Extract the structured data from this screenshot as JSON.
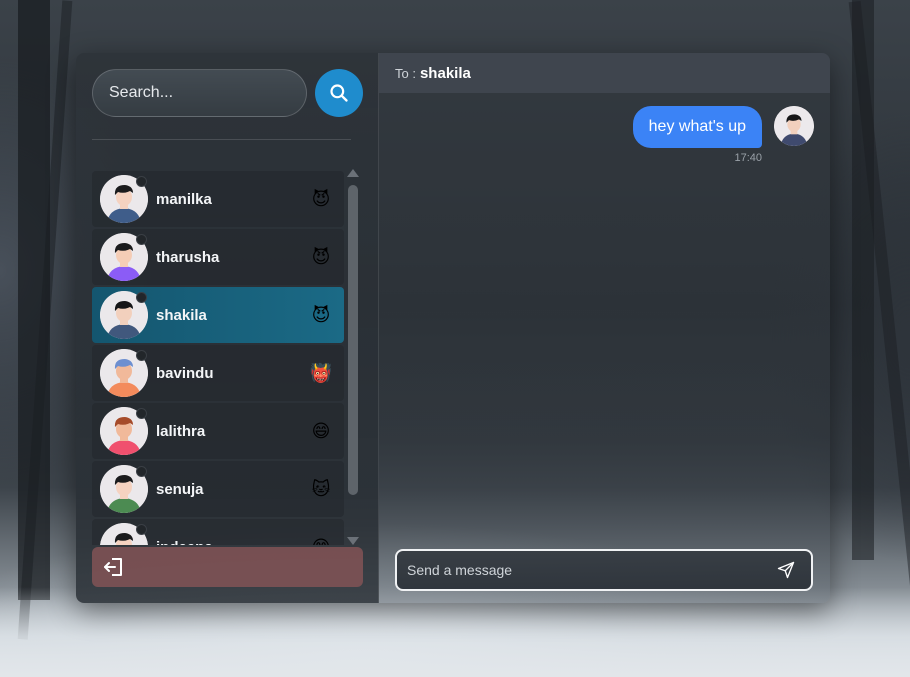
{
  "search": {
    "placeholder": "Search..."
  },
  "contacts": [
    {
      "name": "manilka",
      "emoji": "😈",
      "shirt": "#3f5d8a",
      "hair": "#1b1b1d",
      "skin": "#f5d2c0"
    },
    {
      "name": "tharusha",
      "emoji": "😈",
      "shirt": "#8b5cf6",
      "hair": "#1b1b1d",
      "skin": "#f5cdb6"
    },
    {
      "name": "shakila",
      "emoji": "😈",
      "shirt": "#41587d",
      "hair": "#161618",
      "skin": "#f2d0bd"
    },
    {
      "name": "bavindu",
      "emoji": "👹",
      "shirt": "#f38b5c",
      "hair": "#6d8fd0",
      "skin": "#f1b99a"
    },
    {
      "name": "lalithra",
      "emoji": "😄",
      "shirt": "#f0506e",
      "hair": "#a64b2a",
      "skin": "#f1b99a"
    },
    {
      "name": "senuja",
      "emoji": "🐱",
      "shirt": "#4c8b52",
      "hair": "#1b1b1d",
      "skin": "#f5d2c0"
    },
    {
      "name": "indeepa",
      "emoji": "😄",
      "shirt": "#4a5a7a",
      "hair": "#1b1b1d",
      "skin": "#f5d2c0"
    }
  ],
  "active_contact": "shakila",
  "chat": {
    "to_label": "To :",
    "to_name": "shakila",
    "messages": [
      {
        "text": "hey what's up",
        "time": "17:40",
        "from": "me"
      }
    ],
    "composer_placeholder": "Send a message"
  },
  "colors": {
    "accent": "#1f8ccd",
    "bubble": "#3b83f6",
    "active_row": "#14566f",
    "logout": "#835456"
  },
  "icons": {
    "search": "search-icon",
    "logout": "logout-icon",
    "send": "send-icon"
  }
}
